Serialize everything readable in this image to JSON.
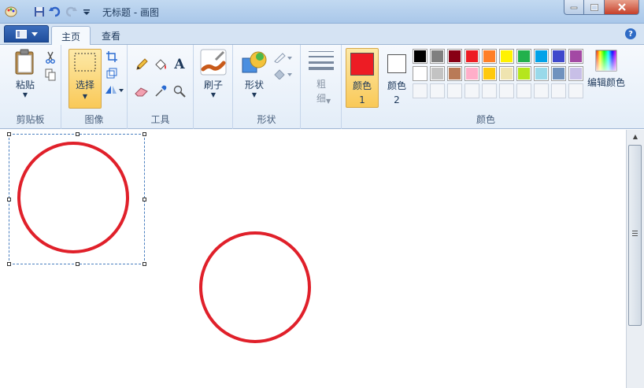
{
  "window": {
    "title": "无标题 - 画图"
  },
  "tabs": [
    {
      "label": "主页",
      "active": true
    },
    {
      "label": "查看",
      "active": false
    }
  ],
  "ribbon": {
    "clipboard": {
      "label": "剪贴板",
      "paste_label": "粘贴"
    },
    "image": {
      "label": "图像",
      "select_label": "选择"
    },
    "tools": {
      "label": "工具"
    },
    "brushes": {
      "label": "刷子"
    },
    "shapes": {
      "label": "形状",
      "shapes_label": "形状"
    },
    "size": {
      "label": "粗细"
    },
    "colors": {
      "label": "颜色",
      "color1_label": "颜色 1",
      "color2_label": "颜色 2",
      "edit_colors_label": "编辑颜色",
      "color1": "#ed1c24",
      "color2": "#ffffff",
      "palette_row1": [
        "#000000",
        "#7f7f7f",
        "#880015",
        "#ed1c24",
        "#ff7f27",
        "#fff200",
        "#22b14c",
        "#00a2e8",
        "#3f48cc",
        "#a349a4"
      ],
      "palette_row2": [
        "#ffffff",
        "#c3c3c3",
        "#b97a57",
        "#ffaec9",
        "#ffc90e",
        "#efe4b0",
        "#b5e61d",
        "#99d9ea",
        "#7092be",
        "#c8bfe7"
      ]
    }
  },
  "canvas": {
    "stroke_color": "#e0202a",
    "circles": [
      {
        "name": "circle-1"
      },
      {
        "name": "circle-2"
      }
    ]
  }
}
